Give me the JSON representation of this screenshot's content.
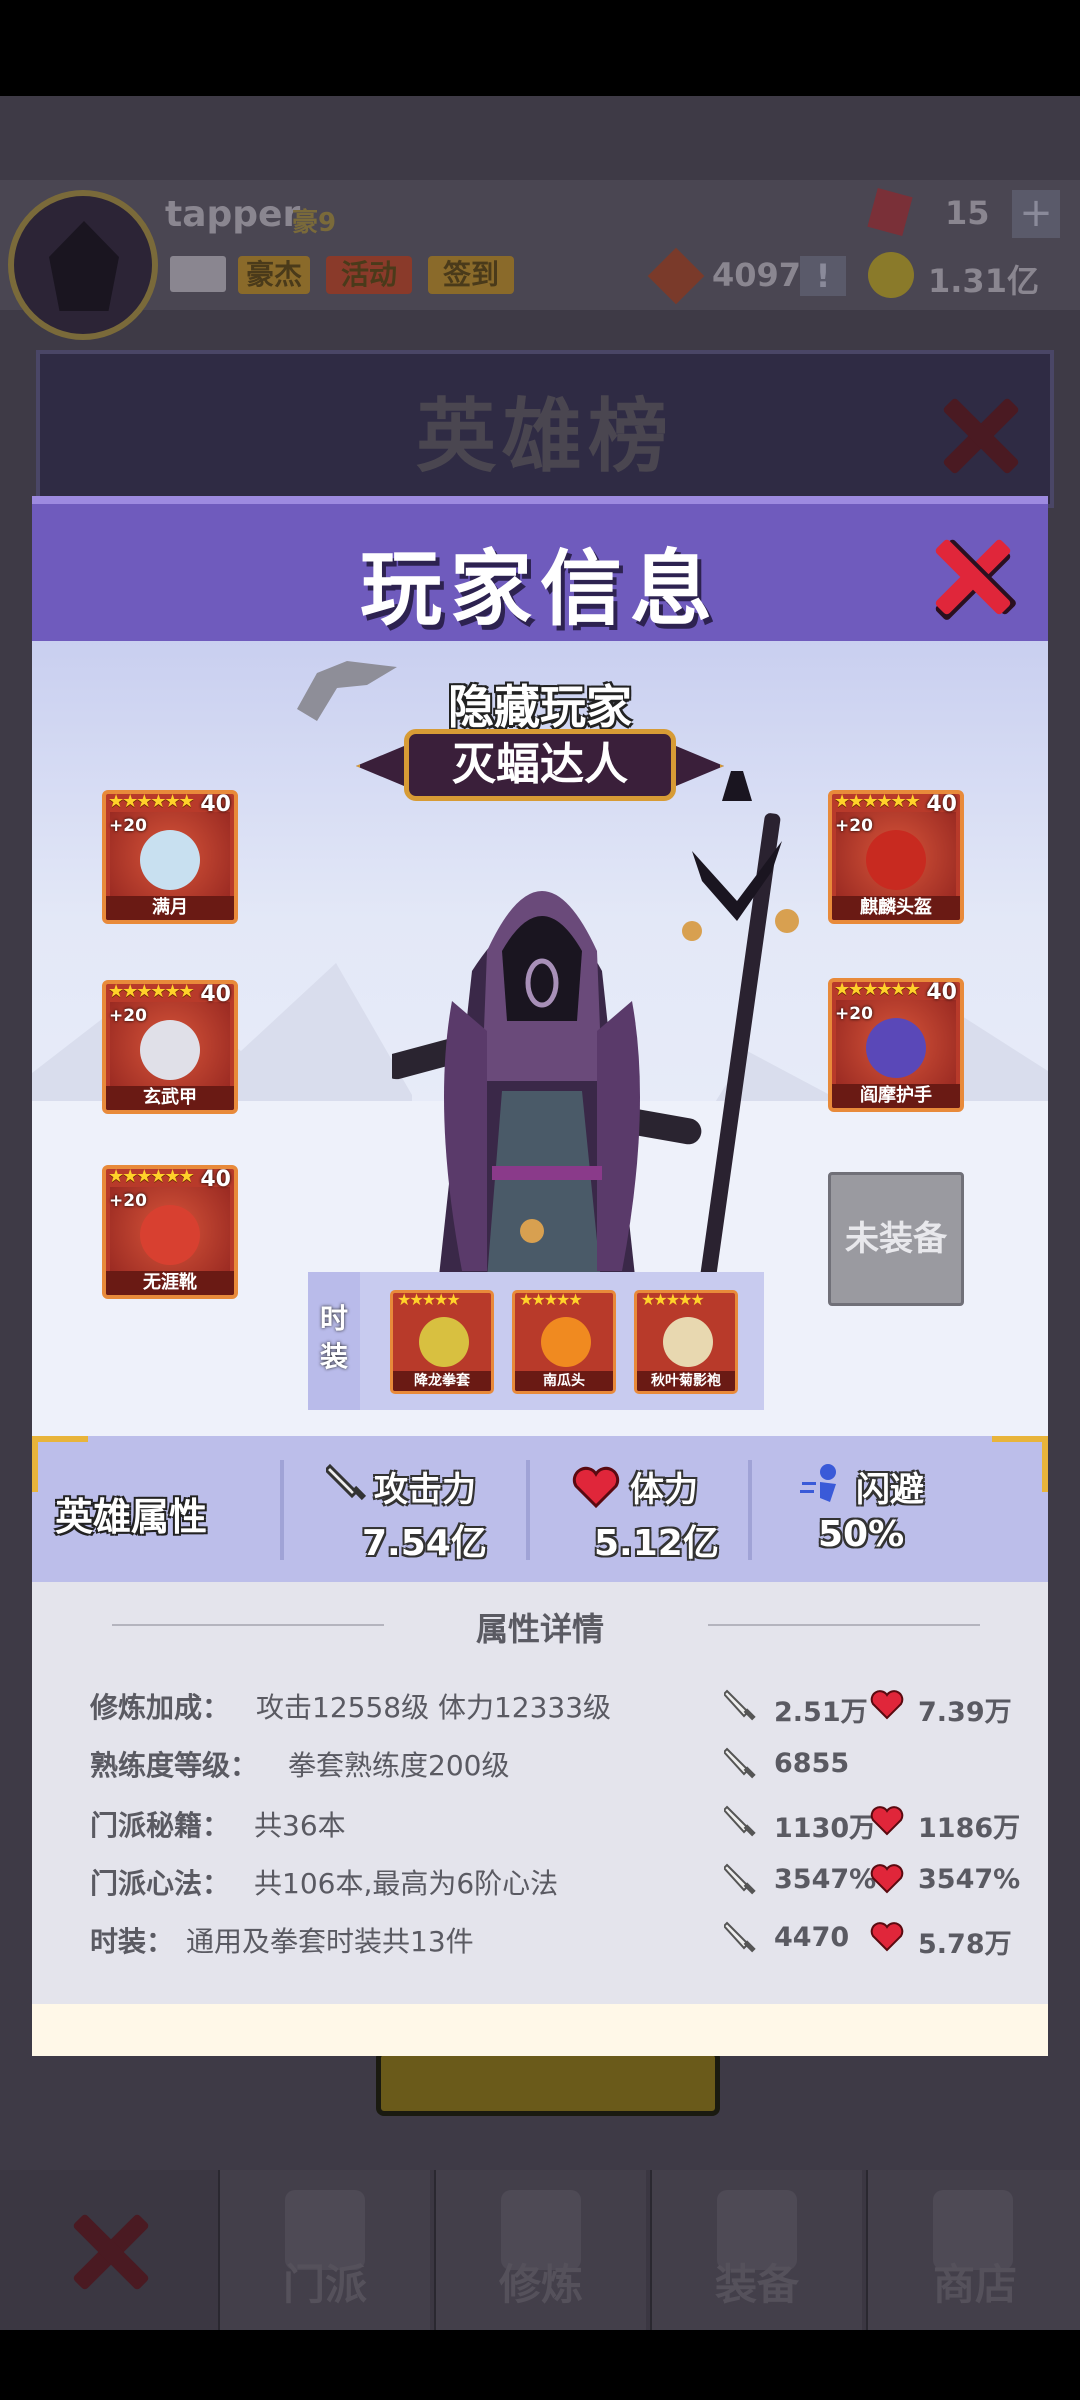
{
  "top": {
    "player_name": "tapper",
    "vip": "豪9",
    "buttons": [
      "豪杰",
      "活动",
      "签到"
    ],
    "gem_count": "15",
    "token_count": "4097",
    "gold": "1.31亿"
  },
  "leaderboard_title": "英雄榜",
  "bottom_nav": [
    "门派",
    "修炼",
    "装备",
    "商店"
  ],
  "modal": {
    "title": "玩家信息",
    "hero_name": "隐藏玩家",
    "hero_title": "灭蝠达人",
    "equipment_left": [
      {
        "name": "满月",
        "level": "40",
        "plus": "+20",
        "stars": "★★★★★★"
      },
      {
        "name": "玄武甲",
        "level": "40",
        "plus": "+20",
        "stars": "★★★★★★"
      },
      {
        "name": "无涯靴",
        "level": "40",
        "plus": "+20",
        "stars": "★★★★★★"
      }
    ],
    "equipment_right": [
      {
        "name": "麒麟头盔",
        "level": "40",
        "plus": "+20",
        "stars": "★★★★★★"
      },
      {
        "name": "阎摩护手",
        "level": "40",
        "plus": "+20",
        "stars": "★★★★★★"
      }
    ],
    "unequipped_label": "未装备",
    "costume_label": "时装",
    "costumes": [
      {
        "name": "降龙拳套",
        "stars": "★★★★★"
      },
      {
        "name": "南瓜头",
        "stars": "★★★★★"
      },
      {
        "name": "秋叶菊影袍",
        "stars": "★★★★★"
      }
    ],
    "attributes": {
      "title": "英雄属性",
      "attack_label": "攻击力",
      "attack_value": "7.54亿",
      "hp_label": "体力",
      "hp_value": "5.12亿",
      "dodge_label": "闪避",
      "dodge_value": "50%"
    },
    "details": {
      "title": "属性详情",
      "rows": [
        {
          "label": "修炼加成：",
          "value": "攻击12558级 体力12333级",
          "atk": "2.51万",
          "hp": "7.39万"
        },
        {
          "label": "熟练度等级：",
          "value": "拳套熟练度200级",
          "atk": "6855",
          "hp": ""
        },
        {
          "label": "门派秘籍：",
          "value": "共36本",
          "atk": "1130万",
          "hp": "1186万"
        },
        {
          "label": "门派心法：",
          "value": "共106本,最高为6阶心法",
          "atk": "3547%",
          "hp": "3547%"
        },
        {
          "label": "时装：",
          "value": "通用及拳套时装共13件",
          "atk": "4470",
          "hp": "5.78万"
        }
      ]
    }
  }
}
